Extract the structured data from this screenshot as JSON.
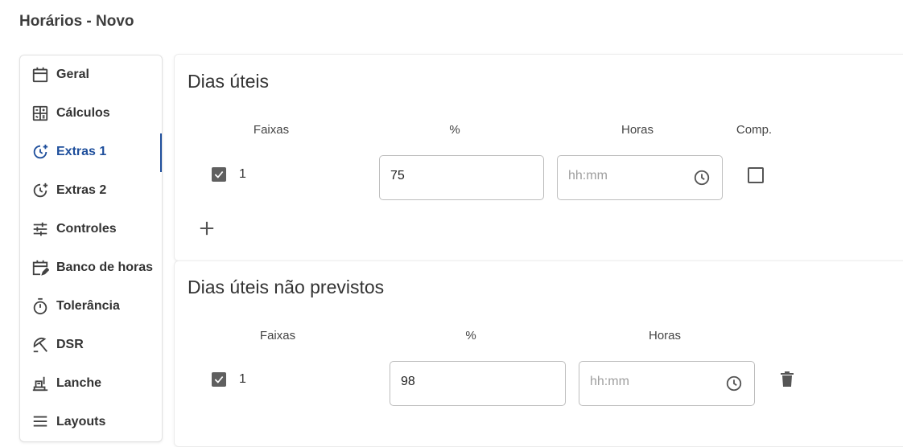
{
  "page": {
    "title": "Horários - Novo"
  },
  "sidebar": {
    "items": [
      {
        "label": "Geral",
        "icon": "calendar-icon",
        "active": false
      },
      {
        "label": "Cálculos",
        "icon": "calculator-icon",
        "active": false
      },
      {
        "label": "Extras 1",
        "icon": "clock-plus-icon",
        "active": true
      },
      {
        "label": "Extras 2",
        "icon": "clock-plus-icon",
        "active": false
      },
      {
        "label": "Controles",
        "icon": "sliders-icon",
        "active": false
      },
      {
        "label": "Banco de horas",
        "icon": "calendar-edit-icon",
        "active": false
      },
      {
        "label": "Tolerância",
        "icon": "timer-icon",
        "active": false
      },
      {
        "label": "DSR",
        "icon": "beach-umbrella-icon",
        "active": false
      },
      {
        "label": "Lanche",
        "icon": "food-tray-icon",
        "active": false
      },
      {
        "label": "Layouts",
        "icon": "layout-icon",
        "active": false
      }
    ]
  },
  "sections": {
    "dias_uteis": {
      "title": "Dias úteis",
      "headers": {
        "faixas": "Faixas",
        "percent": "%",
        "horas": "Horas",
        "comp": "Comp."
      },
      "row": {
        "index": "1",
        "checked": true,
        "percent": "75",
        "horas_placeholder": "hh:mm",
        "comp_checked": false
      }
    },
    "dias_uteis_nao_previstos": {
      "title": "Dias úteis não previstos",
      "headers": {
        "faixas": "Faixas",
        "percent": "%",
        "horas": "Horas"
      },
      "row": {
        "index": "1",
        "checked": true,
        "percent": "98",
        "horas_placeholder": "hh:mm"
      }
    }
  },
  "colors": {
    "accent": "#1f4f9c",
    "icon": "#424242"
  }
}
